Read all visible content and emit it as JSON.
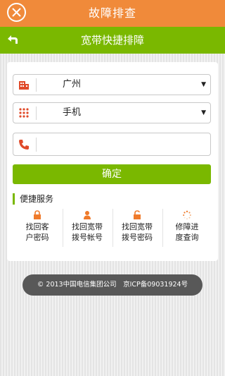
{
  "header": {
    "title": "故障排查",
    "close_icon": "close-icon"
  },
  "subheader": {
    "title": "宽带快捷排障",
    "back_icon": "back-arrow-icon"
  },
  "form": {
    "city": {
      "value": "广州",
      "icon": "building-icon"
    },
    "type": {
      "value": "手机",
      "icon": "grid-icon"
    },
    "phone": {
      "value": "",
      "placeholder": "",
      "icon": "phone-icon"
    },
    "confirm_label": "确定"
  },
  "services": {
    "title": "便捷服务",
    "items": [
      {
        "line1": "找回客",
        "line2": "户密码",
        "icon": "lock-icon"
      },
      {
        "line1": "找回宽带",
        "line2": "拨号帐号",
        "icon": "user-icon"
      },
      {
        "line1": "找回宽带",
        "line2": "拨号密码",
        "icon": "unlock-icon"
      },
      {
        "line1": "修障进",
        "line2": "度查询",
        "icon": "loading-icon"
      }
    ]
  },
  "footer": {
    "text": "© 2013中国电信集团公司　京ICP备09031924号"
  },
  "colors": {
    "orange": "#f08a3a",
    "green": "#7ab800",
    "footer_bg": "#585858"
  }
}
